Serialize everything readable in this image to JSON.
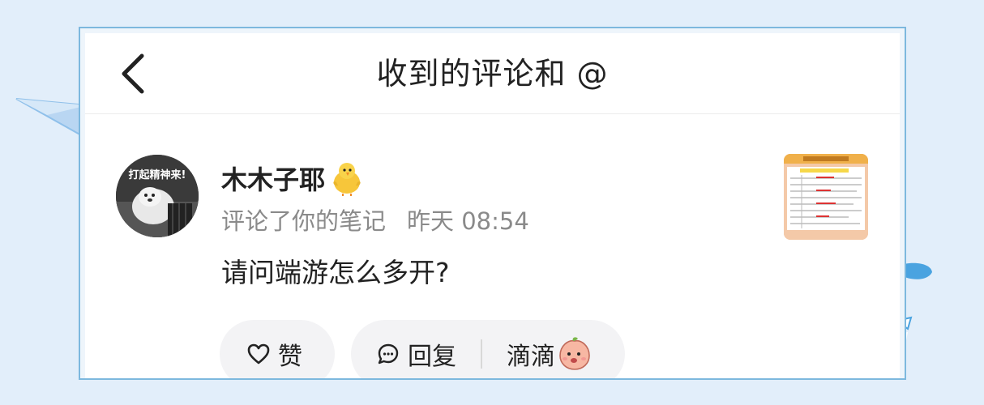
{
  "header": {
    "title": "收到的评论和 @",
    "back_icon": "chevron-left-icon"
  },
  "comment": {
    "avatar_caption": "打起精神来!",
    "username": "木木子耶",
    "username_badge": "chick-emoji-icon",
    "action_text": "评论了你的笔记",
    "timestamp": "昨天 08:54",
    "content": "请问端游怎么多开?",
    "note_thumbnail": "note-thumbnail"
  },
  "actions": {
    "like_label": "赞",
    "like_icon": "heart-outline-icon",
    "reply_label": "回复",
    "reply_icon": "chat-bubble-icon",
    "quick_reply_label": "滴滴",
    "quick_reply_icon": "peach-emoji-icon"
  },
  "colors": {
    "background": "#e2eefa",
    "frame_border": "#7db8de",
    "text_primary": "#222222",
    "text_secondary": "#8a8a8a",
    "pill_bg": "#f3f3f5"
  }
}
